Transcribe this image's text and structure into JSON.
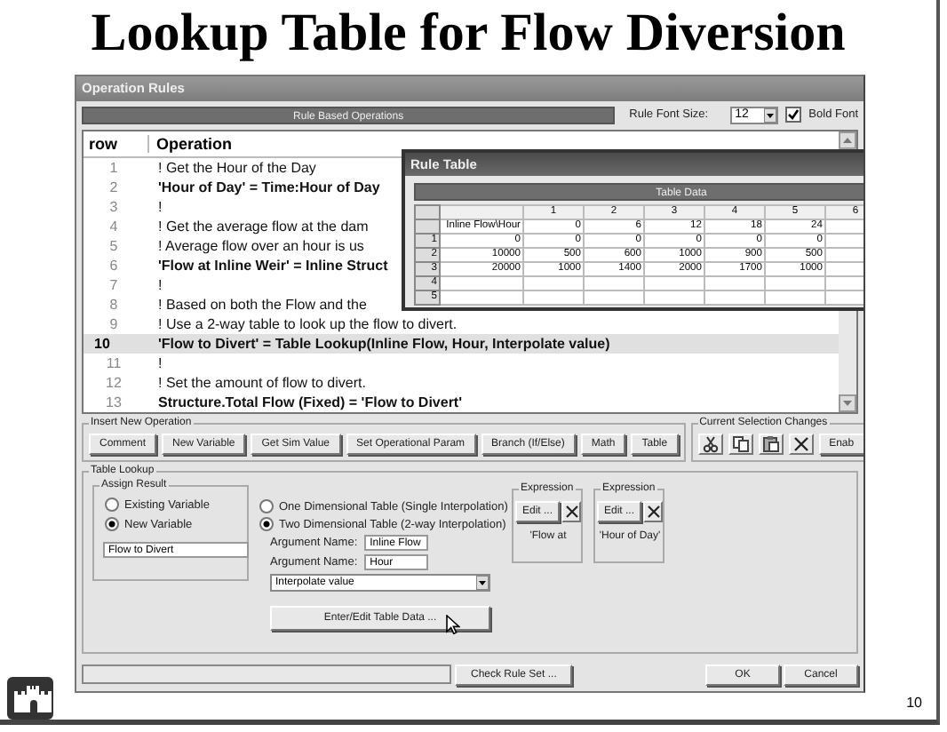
{
  "slide": {
    "title": "Lookup Table for Flow Diversion",
    "page_number": "10"
  },
  "window": {
    "title": "Operation Rules"
  },
  "rules_header": {
    "title": "Rule Based Operations",
    "font_size_label": "Rule Font Size:",
    "font_size": "12",
    "bold_font": {
      "label": "Bold Font",
      "checked": true
    }
  },
  "rules": {
    "columns": [
      "row",
      "Operation"
    ],
    "rows": [
      {
        "number": "1",
        "text": "! Get the Hour of the Day",
        "bold": false,
        "selected": false
      },
      {
        "number": "2",
        "text": "'Hour of Day' = Time:Hour of Day",
        "bold": true,
        "selected": false
      },
      {
        "number": "3",
        "text": "!",
        "bold": false,
        "selected": false
      },
      {
        "number": "4",
        "text": "! Get the average flow at the dam",
        "bold": false,
        "selected": false
      },
      {
        "number": "5",
        "text": "! Average flow over an hour is us",
        "bold": false,
        "selected": false
      },
      {
        "number": "6",
        "text": "'Flow at Inline Weir' = Inline Struct",
        "bold": true,
        "selected": false
      },
      {
        "number": "7",
        "text": "!",
        "bold": false,
        "selected": false
      },
      {
        "number": "8",
        "text": "! Based on both the Flow and the",
        "bold": false,
        "selected": false
      },
      {
        "number": "9",
        "text": "! Use a 2-way table to look up the flow to divert.",
        "bold": false,
        "selected": false
      },
      {
        "number": "10",
        "text": "'Flow to Divert' = Table Lookup(Inline Flow, Hour, Interpolate value)",
        "bold": true,
        "selected": true
      },
      {
        "number": "11",
        "text": "!",
        "bold": false,
        "selected": false
      },
      {
        "number": "12",
        "text": "! Set the amount of flow to divert.",
        "bold": false,
        "selected": false
      },
      {
        "number": "13",
        "text": "Structure.Total Flow (Fixed) = 'Flow to Divert'",
        "bold": true,
        "selected": false
      }
    ]
  },
  "rule_table": {
    "title": "Rule Table",
    "header": "Table Data",
    "columns": [
      "",
      "1",
      "2",
      "3",
      "4",
      "5",
      "6"
    ],
    "rows": [
      {
        "number": "",
        "cells": [
          "Inline Flow\\Hour",
          "0",
          "6",
          "12",
          "18",
          "24"
        ]
      },
      {
        "number": "1",
        "cells": [
          "0",
          "0",
          "0",
          "0",
          "0",
          "0"
        ]
      },
      {
        "number": "2",
        "cells": [
          "10000",
          "500",
          "600",
          "1000",
          "900",
          "500"
        ]
      },
      {
        "number": "3",
        "cells": [
          "20000",
          "1000",
          "1400",
          "2000",
          "1700",
          "1000"
        ]
      },
      {
        "number": "4",
        "cells": []
      },
      {
        "number": "5",
        "cells": []
      }
    ]
  },
  "insert_new_operation": {
    "title": "Insert New Operation",
    "buttons": [
      "Comment",
      "New Variable",
      "Get Sim Value",
      "Set Operational Param",
      "Branch (If/Else)",
      "Math",
      "Table"
    ]
  },
  "current_selection_changes": {
    "title": "Current Selection Changes",
    "tools": [
      {
        "kind": "cut"
      },
      {
        "kind": "copy"
      },
      {
        "kind": "paste"
      },
      {
        "kind": "delete"
      }
    ],
    "buttons": [
      "Enab"
    ]
  },
  "table_lookup": {
    "title": "Table Lookup",
    "assign_result": {
      "title": "Assign Result",
      "options": [
        {
          "label": "Existing Variable",
          "selected": false
        },
        {
          "label": "New Variable",
          "selected": true
        }
      ],
      "variable_name": "Flow to Divert"
    },
    "table_types": [
      {
        "label": "One Dimensional Table (Single Interpolation)",
        "selected": false
      },
      {
        "label": "Two Dimensional Table (2-way Interpolation)",
        "selected": true
      }
    ],
    "arguments": [
      {
        "label": "Argument Name:",
        "value": "Inline Flow"
      },
      {
        "label": "Argument Name:",
        "value": "Hour"
      }
    ],
    "method": "Interpolate value",
    "edit_table_button": "Enter/Edit Table Data ...",
    "expressions": [
      {
        "title": "Expression",
        "edit_button": "Edit ...",
        "value": "'Flow at"
      },
      {
        "title": "Expression",
        "edit_button": "Edit ...",
        "value": "'Hour of Day'"
      }
    ]
  },
  "footer": {
    "check_button": "Check Rule Set ...",
    "ok_button": "OK",
    "cancel_button": "Cancel"
  }
}
